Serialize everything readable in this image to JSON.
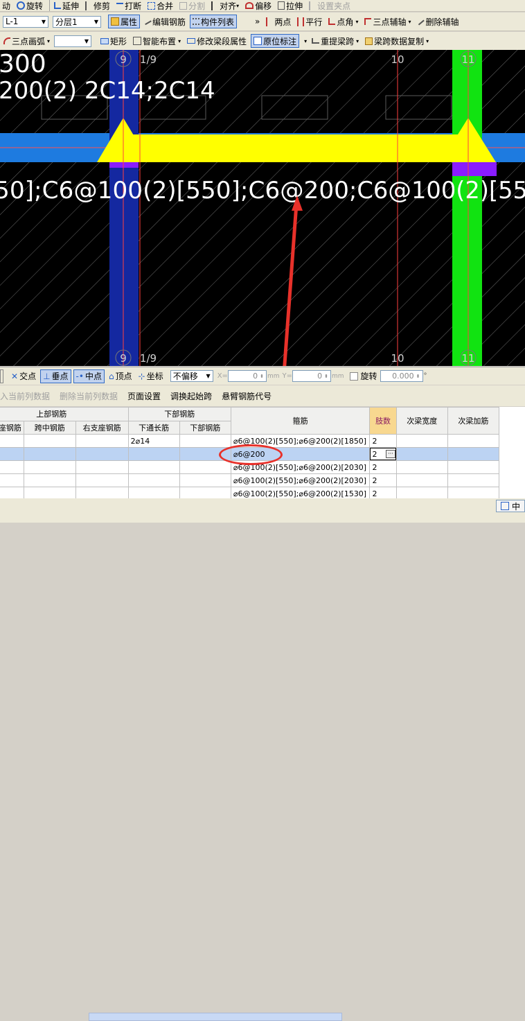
{
  "toolbar1": {
    "items": [
      "动",
      "旋转",
      "延伸",
      "修剪",
      "打断",
      "合并",
      "分割",
      "对齐",
      "偏移",
      "拉伸",
      "设置夹点"
    ]
  },
  "toolbar2": {
    "element_value": "L-1",
    "layer_value": "分层1",
    "properties": "属性",
    "edit_rebar": "编辑钢筋",
    "component_list": "构件列表",
    "more": "»",
    "two_point": "两点",
    "parallel": "平行",
    "point_angle": "点角",
    "three_point_aux": "三点辅轴",
    "delete_aux": "删除辅轴"
  },
  "toolbar3": {
    "arc": "三点画弧",
    "rect": "矩形",
    "smart_layout": "智能布置",
    "modify_span_props": "修改梁段属性",
    "in_situ_label": "原位标注",
    "re_extract_span": "重提梁跨",
    "copy_beam_data": "梁跨数据复制"
  },
  "drawing": {
    "text1": "300",
    "text2": "200(2) 2C14;2C14",
    "stirrup_text_a": "50];C6@100(2)[550];C6@200",
    "stirrup_text_b": ";C6@100(2)[55",
    "axis_labels_top": [
      "9",
      "1/9",
      "10",
      "11"
    ],
    "axis_labels_bottom": [
      "9",
      "1/9",
      "10",
      "11"
    ],
    "colors": {
      "background": "#000000",
      "beam_band": "#1e7be0",
      "beam_yellow": "#ffff00",
      "column_blue": "#1428a0",
      "column_green": "#11e311",
      "purple": "#8a1cff",
      "axis_line": "#ff3030",
      "annotation_red": "#e8312a"
    }
  },
  "snapbar": {
    "intersection": "交点",
    "perpendicular": "垂点",
    "midpoint": "中点",
    "vertex": "顶点",
    "coordinate": "坐标",
    "offset_mode": "不偏移",
    "x_label": "X=",
    "x_value": "0",
    "y_label": "Y=",
    "y_value": "0",
    "unit": "mm",
    "rotate": "旋转",
    "rotate_value": "0.000",
    "degree": "°"
  },
  "actions": {
    "insert_col": "入当前列数据",
    "delete_col": "删除当前列数据",
    "page_setup": "页面设置",
    "swap_start": "调换起始跨",
    "cantilever_code": "悬臂钢筋代号"
  },
  "table": {
    "group_top": "上部钢筋",
    "group_bottom": "下部钢筋",
    "col_left_support": "座钢筋",
    "col_mid_span": "跨中钢筋",
    "col_right_support": "右支座钢筋",
    "col_bottom_through": "下通长筋",
    "col_bottom_rebar": "下部钢筋",
    "col_stirrup": "箍筋",
    "col_legs": "肢数",
    "col_secondary_width": "次梁宽度",
    "col_secondary_add": "次梁加筋",
    "rows": [
      {
        "bottom_through": "2⌀14",
        "stirrup": "⌀6@100(2)[550];⌀6@200(2)[1850]",
        "legs": "2"
      },
      {
        "bottom_through": "",
        "stirrup": "⌀6@200",
        "legs": "2"
      },
      {
        "bottom_through": "",
        "stirrup": "⌀6@100(2)[550];⌀6@200(2)[2030]",
        "legs": "2"
      },
      {
        "bottom_through": "",
        "stirrup": "⌀6@100(2)[550];⌀6@200(2)[2030]",
        "legs": "2"
      },
      {
        "bottom_through": "",
        "stirrup": "⌀6@100(2)[550];⌀6@200(2)[1530]",
        "legs": "2"
      }
    ]
  },
  "status": {
    "ime": "中"
  }
}
